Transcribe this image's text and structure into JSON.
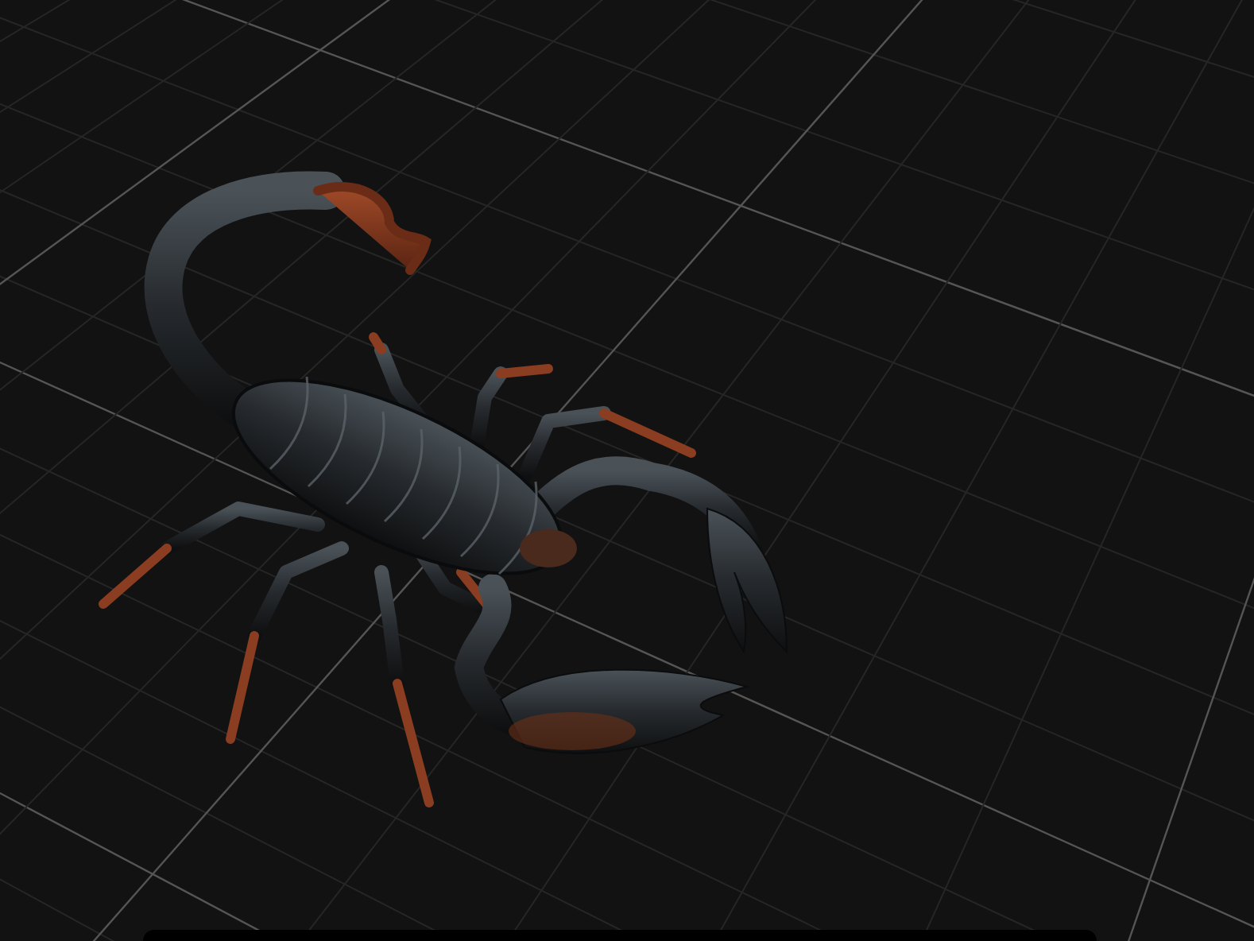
{
  "viewport": {
    "grid": true,
    "model": true,
    "bottom_panel": true
  }
}
